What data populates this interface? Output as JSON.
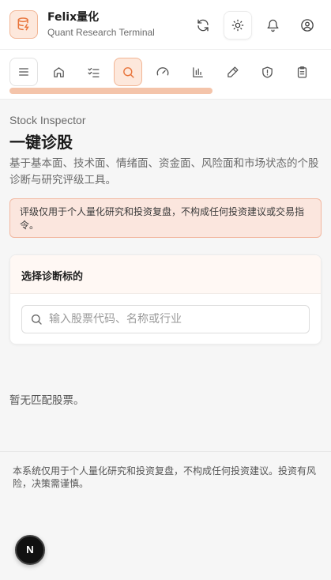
{
  "app": {
    "name": "Felix量化",
    "subtitle": "Quant Research Terminal",
    "logo_icon": "database-icon",
    "accent": "#e8743b"
  },
  "header_actions": [
    {
      "name": "refresh",
      "icon": "refresh-icon"
    },
    {
      "name": "theme",
      "icon": "sun-icon"
    },
    {
      "name": "notifications",
      "icon": "bell-icon"
    },
    {
      "name": "account",
      "icon": "user-circle-icon"
    }
  ],
  "nav": {
    "items": [
      {
        "name": "menu",
        "icon": "menu-icon"
      },
      {
        "name": "home",
        "icon": "home-icon"
      },
      {
        "name": "tasks",
        "icon": "checklist-icon"
      },
      {
        "name": "stock-inspector",
        "icon": "search-icon",
        "active": true
      },
      {
        "name": "dashboard",
        "icon": "gauge-icon"
      },
      {
        "name": "charts",
        "icon": "bar-chart-icon"
      },
      {
        "name": "tools",
        "icon": "pen-icon"
      },
      {
        "name": "risk",
        "icon": "shield-icon"
      },
      {
        "name": "reports",
        "icon": "clipboard-icon"
      }
    ]
  },
  "page": {
    "eyebrow": "Stock Inspector",
    "title": "一键诊股",
    "description": "基于基本面、技术面、情绪面、资金面、风险面和市场状态的个股诊断与研究评级工具。",
    "warning": "评级仅用于个人量化研究和投资复盘，不构成任何投资建议或交易指令。"
  },
  "search_card": {
    "heading": "选择诊断标的",
    "placeholder": "输入股票代码、名称或行业",
    "value": ""
  },
  "empty_state": "暂无匹配股票。",
  "footer": {
    "disclaimer": "本系统仅用于个人量化研究和投资复盘，不构成任何投资建议。投资有风险，决策需谨慎。"
  },
  "fab": {
    "letter": "N"
  }
}
